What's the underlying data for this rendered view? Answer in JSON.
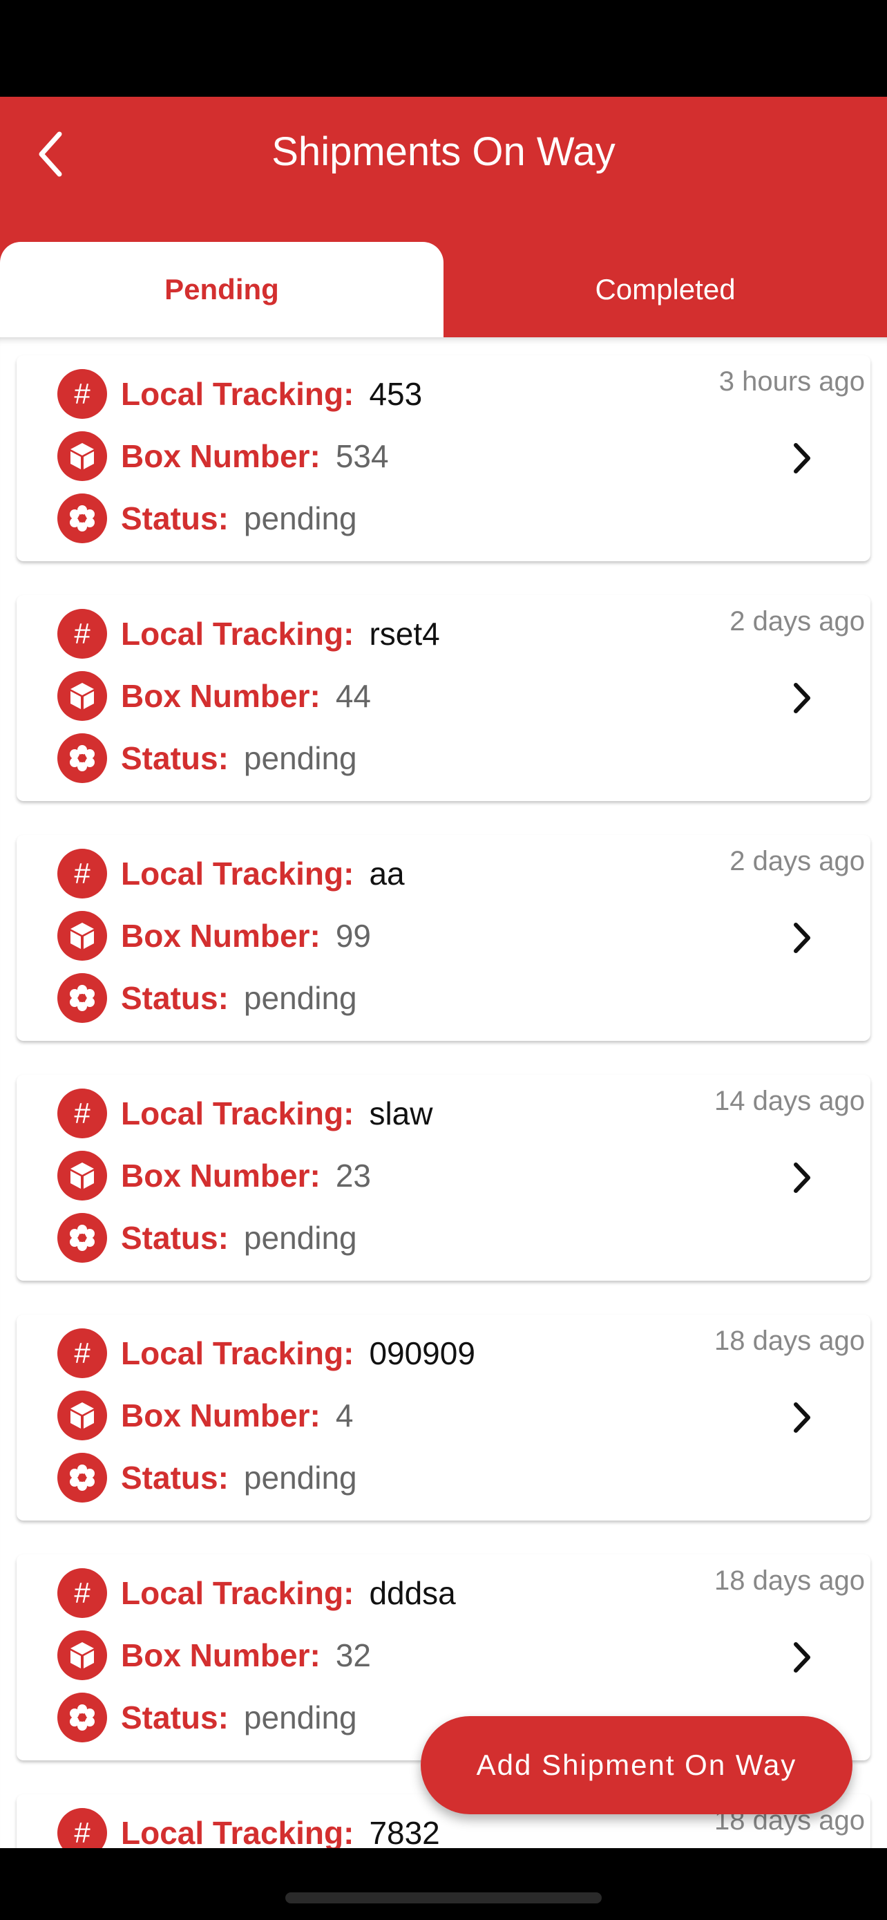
{
  "header": {
    "title": "Shipments On Way",
    "back_icon": "chevron-left-icon"
  },
  "tabs": [
    {
      "label": "Pending",
      "active": true
    },
    {
      "label": "Completed",
      "active": false
    }
  ],
  "labels": {
    "local_tracking": "Local Tracking:",
    "box_number": "Box Number:",
    "status": "Status:"
  },
  "shipments": [
    {
      "local_tracking": "453",
      "box_number": "534",
      "status": "pending",
      "time": "3 hours ago"
    },
    {
      "local_tracking": "rset4",
      "box_number": "44",
      "status": "pending",
      "time": "2 days ago"
    },
    {
      "local_tracking": "aa",
      "box_number": "99",
      "status": "pending",
      "time": "2 days ago"
    },
    {
      "local_tracking": "slaw",
      "box_number": "23",
      "status": "pending",
      "time": "14 days ago"
    },
    {
      "local_tracking": "090909",
      "box_number": "4",
      "status": "pending",
      "time": "18 days ago"
    },
    {
      "local_tracking": "dddsa",
      "box_number": "32",
      "status": "pending",
      "time": "18 days ago"
    },
    {
      "local_tracking": "7832",
      "box_number": "",
      "status": "",
      "time": "18 days ago"
    }
  ],
  "fab": {
    "label": "Add Shipment On Way"
  },
  "colors": {
    "accent": "#D32F2F",
    "label": "#D32F2F",
    "muted": "#888888"
  }
}
